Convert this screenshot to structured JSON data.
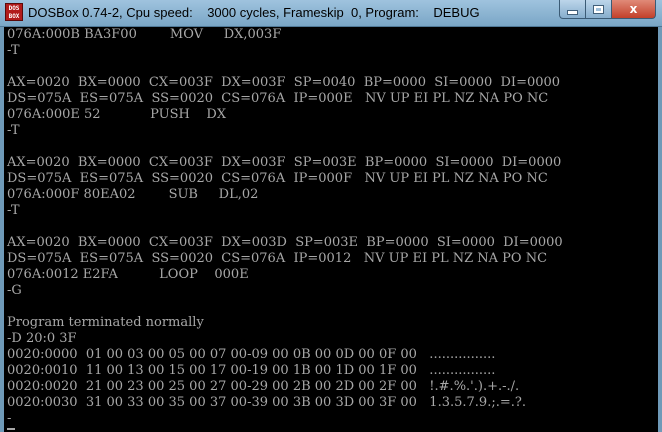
{
  "window": {
    "icon_text": "DOS BOX",
    "title": "DOSBox 0.74-2, Cpu speed:    3000 cycles, Frameskip  0, Program:    DEBUG",
    "close_glyph": "x"
  },
  "console": {
    "lines": [
      "076A:000B BA3F00        MOV     DX,003F",
      "-T",
      "",
      "AX=0020  BX=0000  CX=003F  DX=003F  SP=0040  BP=0000  SI=0000  DI=0000",
      "DS=075A  ES=075A  SS=0020  CS=076A  IP=000E   NV UP EI PL NZ NA PO NC",
      "076A:000E 52            PUSH    DX",
      "-T",
      "",
      "AX=0020  BX=0000  CX=003F  DX=003F  SP=003E  BP=0000  SI=0000  DI=0000",
      "DS=075A  ES=075A  SS=0020  CS=076A  IP=000F   NV UP EI PL NZ NA PO NC",
      "076A:000F 80EA02        SUB     DL,02",
      "-T",
      "",
      "AX=0020  BX=0000  CX=003F  DX=003D  SP=003E  BP=0000  SI=0000  DI=0000",
      "DS=075A  ES=075A  SS=0020  CS=076A  IP=0012   NV UP EI PL NZ NA PO NC",
      "076A:0012 E2FA          LOOP    000E",
      "-G",
      "",
      "Program terminated normally",
      "-D 20:0 3F",
      "0020:0000  01 00 03 00 05 00 07 00-09 00 0B 00 0D 00 0F 00   ................",
      "0020:0010  11 00 13 00 15 00 17 00-19 00 1B 00 1D 00 1F 00   ................",
      "0020:0020  21 00 23 00 25 00 27 00-29 00 2B 00 2D 00 2F 00   !.#.%.'.).+.-./.",
      "0020:0030  31 00 33 00 35 00 37 00-39 00 3B 00 3D 00 3F 00   1.3.5.7.9.;.=.?.",
      "-"
    ]
  }
}
